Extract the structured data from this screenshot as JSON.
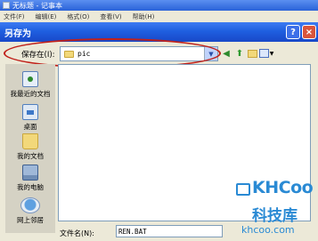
{
  "notepad": {
    "title": "无标题 - 记事本",
    "menu": [
      "文件(F)",
      "编辑(E)",
      "格式(O)",
      "查看(V)",
      "帮助(H)"
    ]
  },
  "dialog": {
    "title": "另存为",
    "help_symbol": "?",
    "close_symbol": "×",
    "save_in_label": "保存在(I):",
    "save_in_value": "pic",
    "places": [
      "我最近的文档",
      "桌面",
      "我的文档",
      "我的电脑",
      "网上邻居"
    ],
    "file_name_label": "文件名(N):",
    "file_name_value": "REN.BAT"
  },
  "watermark": {
    "brand": "KHCoo",
    "chinese": "科技库",
    "domain": "khcoo.com"
  }
}
